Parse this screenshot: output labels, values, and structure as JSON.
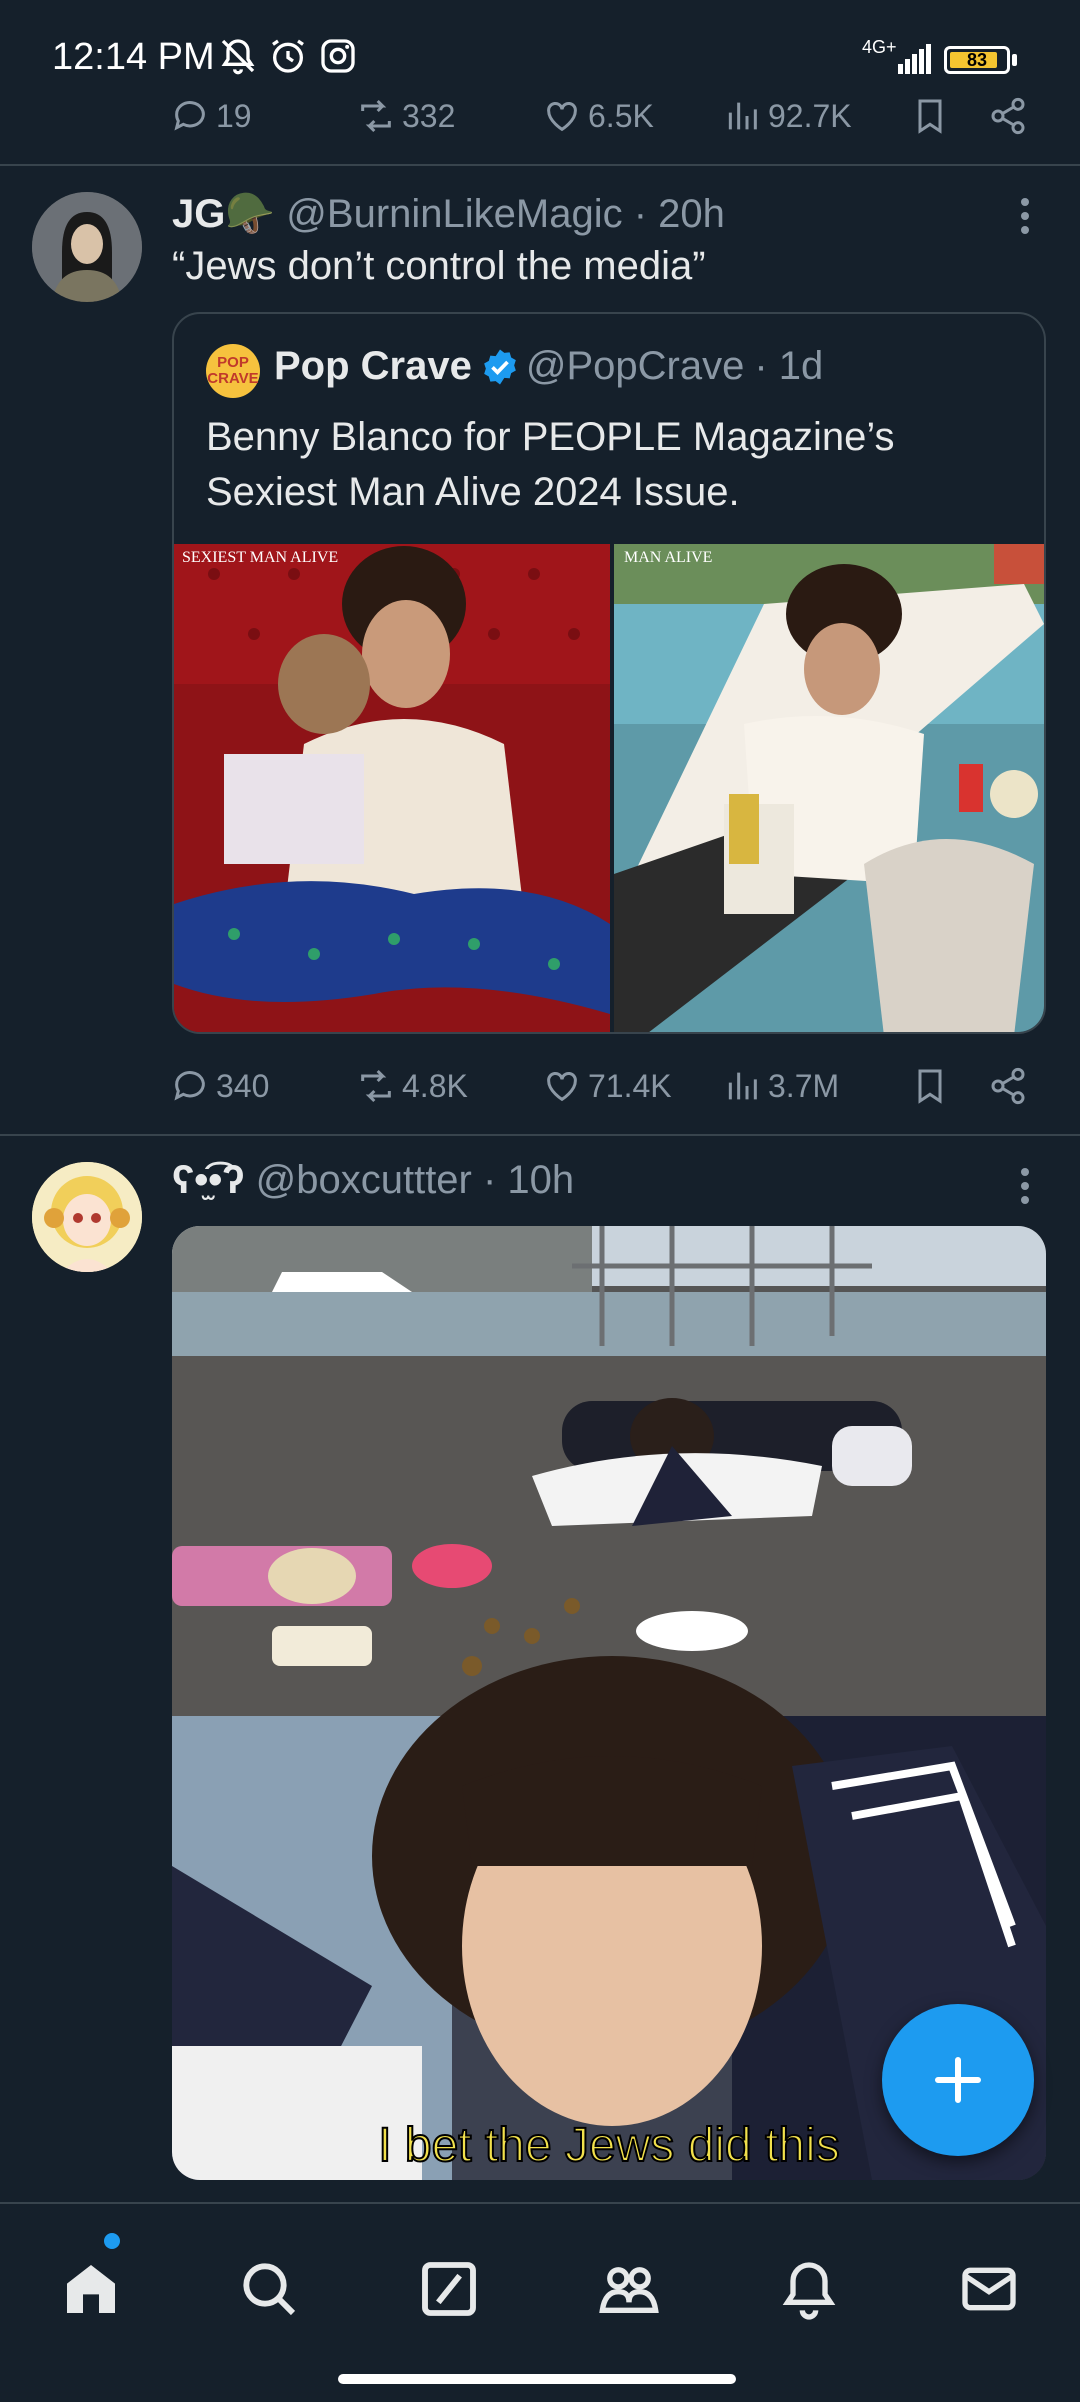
{
  "status_bar": {
    "time": "12:14 PM",
    "network": "4G+",
    "battery": "83",
    "icons": [
      "mute-bell-icon",
      "alarm-icon",
      "instagram-icon",
      "signal-icon",
      "battery-icon"
    ]
  },
  "prev_tweet_actions": {
    "replies": "19",
    "retweets": "332",
    "likes": "6.5K",
    "views": "92.7K"
  },
  "tweet1": {
    "display_name": "JG",
    "emoji": "🪖",
    "handle": "@BurninLikeMagic",
    "time": "· 20h",
    "text": "“Jews don’t control the media”",
    "quote": {
      "display_name": "Pop Crave",
      "handle": "@PopCrave",
      "time": "· 1d",
      "avatar_text": "POP CRAVE",
      "text": "Benny Blanco for PEOPLE Magazine’s Sexiest Man Alive 2024 Issue.",
      "image1_overlay": "SEXIEST MAN ALIVE",
      "image2_overlay": "MAN ALIVE"
    },
    "actions": {
      "replies": "340",
      "retweets": "4.8K",
      "likes": "71.4K",
      "views": "3.7M"
    }
  },
  "tweet2": {
    "display_name": "ʕ•̫͡•ʔ",
    "handle": "@boxcuttter",
    "time": "· 10h",
    "image_caption": "I bet the Jews did this"
  },
  "colors": {
    "background": "#15202B",
    "accent": "#1D9BF0",
    "muted": "#8B98A5",
    "divider": "#38444D"
  },
  "nav": [
    "home-icon",
    "search-icon",
    "grok-icon",
    "communities-icon",
    "notifications-icon",
    "messages-icon"
  ]
}
